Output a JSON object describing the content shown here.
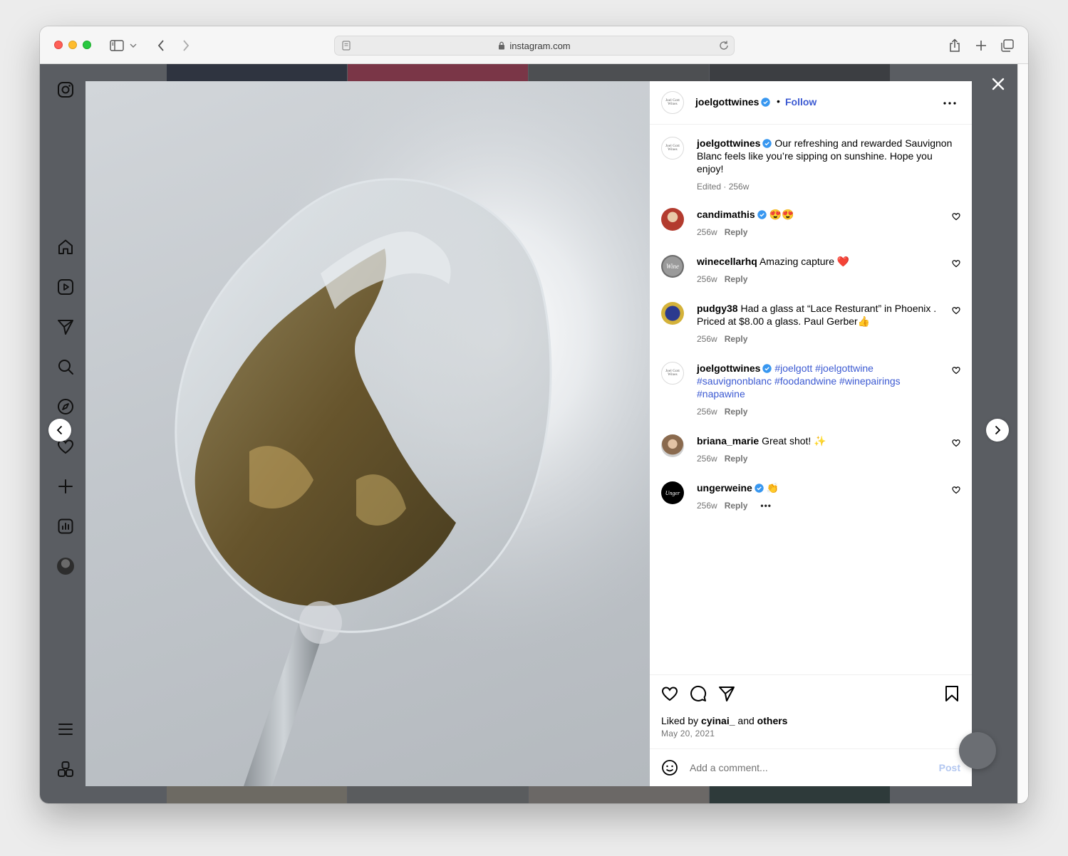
{
  "browser": {
    "url": "instagram.com"
  },
  "post": {
    "author": "joelgottwines",
    "author_avatar_text": "Joel Gott Wines",
    "follow_label": "Follow",
    "separator": "•",
    "caption": {
      "user": "joelgottwines",
      "text": "Our refreshing and rewarded Sauvignon Blanc feels like you’re sipping on sunshine. Hope you enjoy!",
      "meta": "Edited · 256w"
    },
    "comments": [
      {
        "user": "candimathis",
        "verified": true,
        "text": "😍😍",
        "time": "256w",
        "reply": "Reply"
      },
      {
        "user": "winecellarhq",
        "verified": false,
        "text": "Amazing capture ❤️",
        "time": "256w",
        "reply": "Reply",
        "avatar_text": "Wine"
      },
      {
        "user": "pudgy38",
        "verified": false,
        "text": "Had a glass at “Lace Resturant” in Phoenix . Priced at $8.00 a glass. Paul Gerber👍",
        "time": "256w",
        "reply": "Reply"
      },
      {
        "user": "joelgottwines",
        "verified": true,
        "tags": "#joelgott #joelgottwine #sauvignonblanc #foodandwine #winepairings #napawine",
        "time": "256w",
        "reply": "Reply",
        "avatar_text": "Joel Gott Wines"
      },
      {
        "user": "briana_marie",
        "verified": false,
        "text": "Great shot! ✨",
        "time": "256w",
        "reply": "Reply"
      },
      {
        "user": "ungerweine",
        "verified": true,
        "text": "👏",
        "time": "256w",
        "reply": "Reply",
        "more": "•••",
        "avatar_text": "Unger"
      }
    ],
    "liked_by": {
      "prefix": "Liked by",
      "user": "cyinai_",
      "conj": "and",
      "others": "others"
    },
    "date": "May 20, 2021",
    "add_comment_placeholder": "Add a comment...",
    "post_label": "Post"
  },
  "icons": {
    "sidebar": [
      "instagram-icon",
      "home-icon",
      "reels-icon",
      "messages-icon",
      "search-icon",
      "explore-icon",
      "notifications-icon",
      "create-icon",
      "dashboard-icon",
      "profile-avatar",
      "menu-icon",
      "more-apps-icon"
    ],
    "actions": [
      "heart-icon",
      "comment-icon",
      "share-icon",
      "bookmark-icon"
    ]
  },
  "colors": {
    "link_blue": "#3c5ad2",
    "verified_blue": "#3897f0",
    "overlay": "#5a5d62"
  }
}
